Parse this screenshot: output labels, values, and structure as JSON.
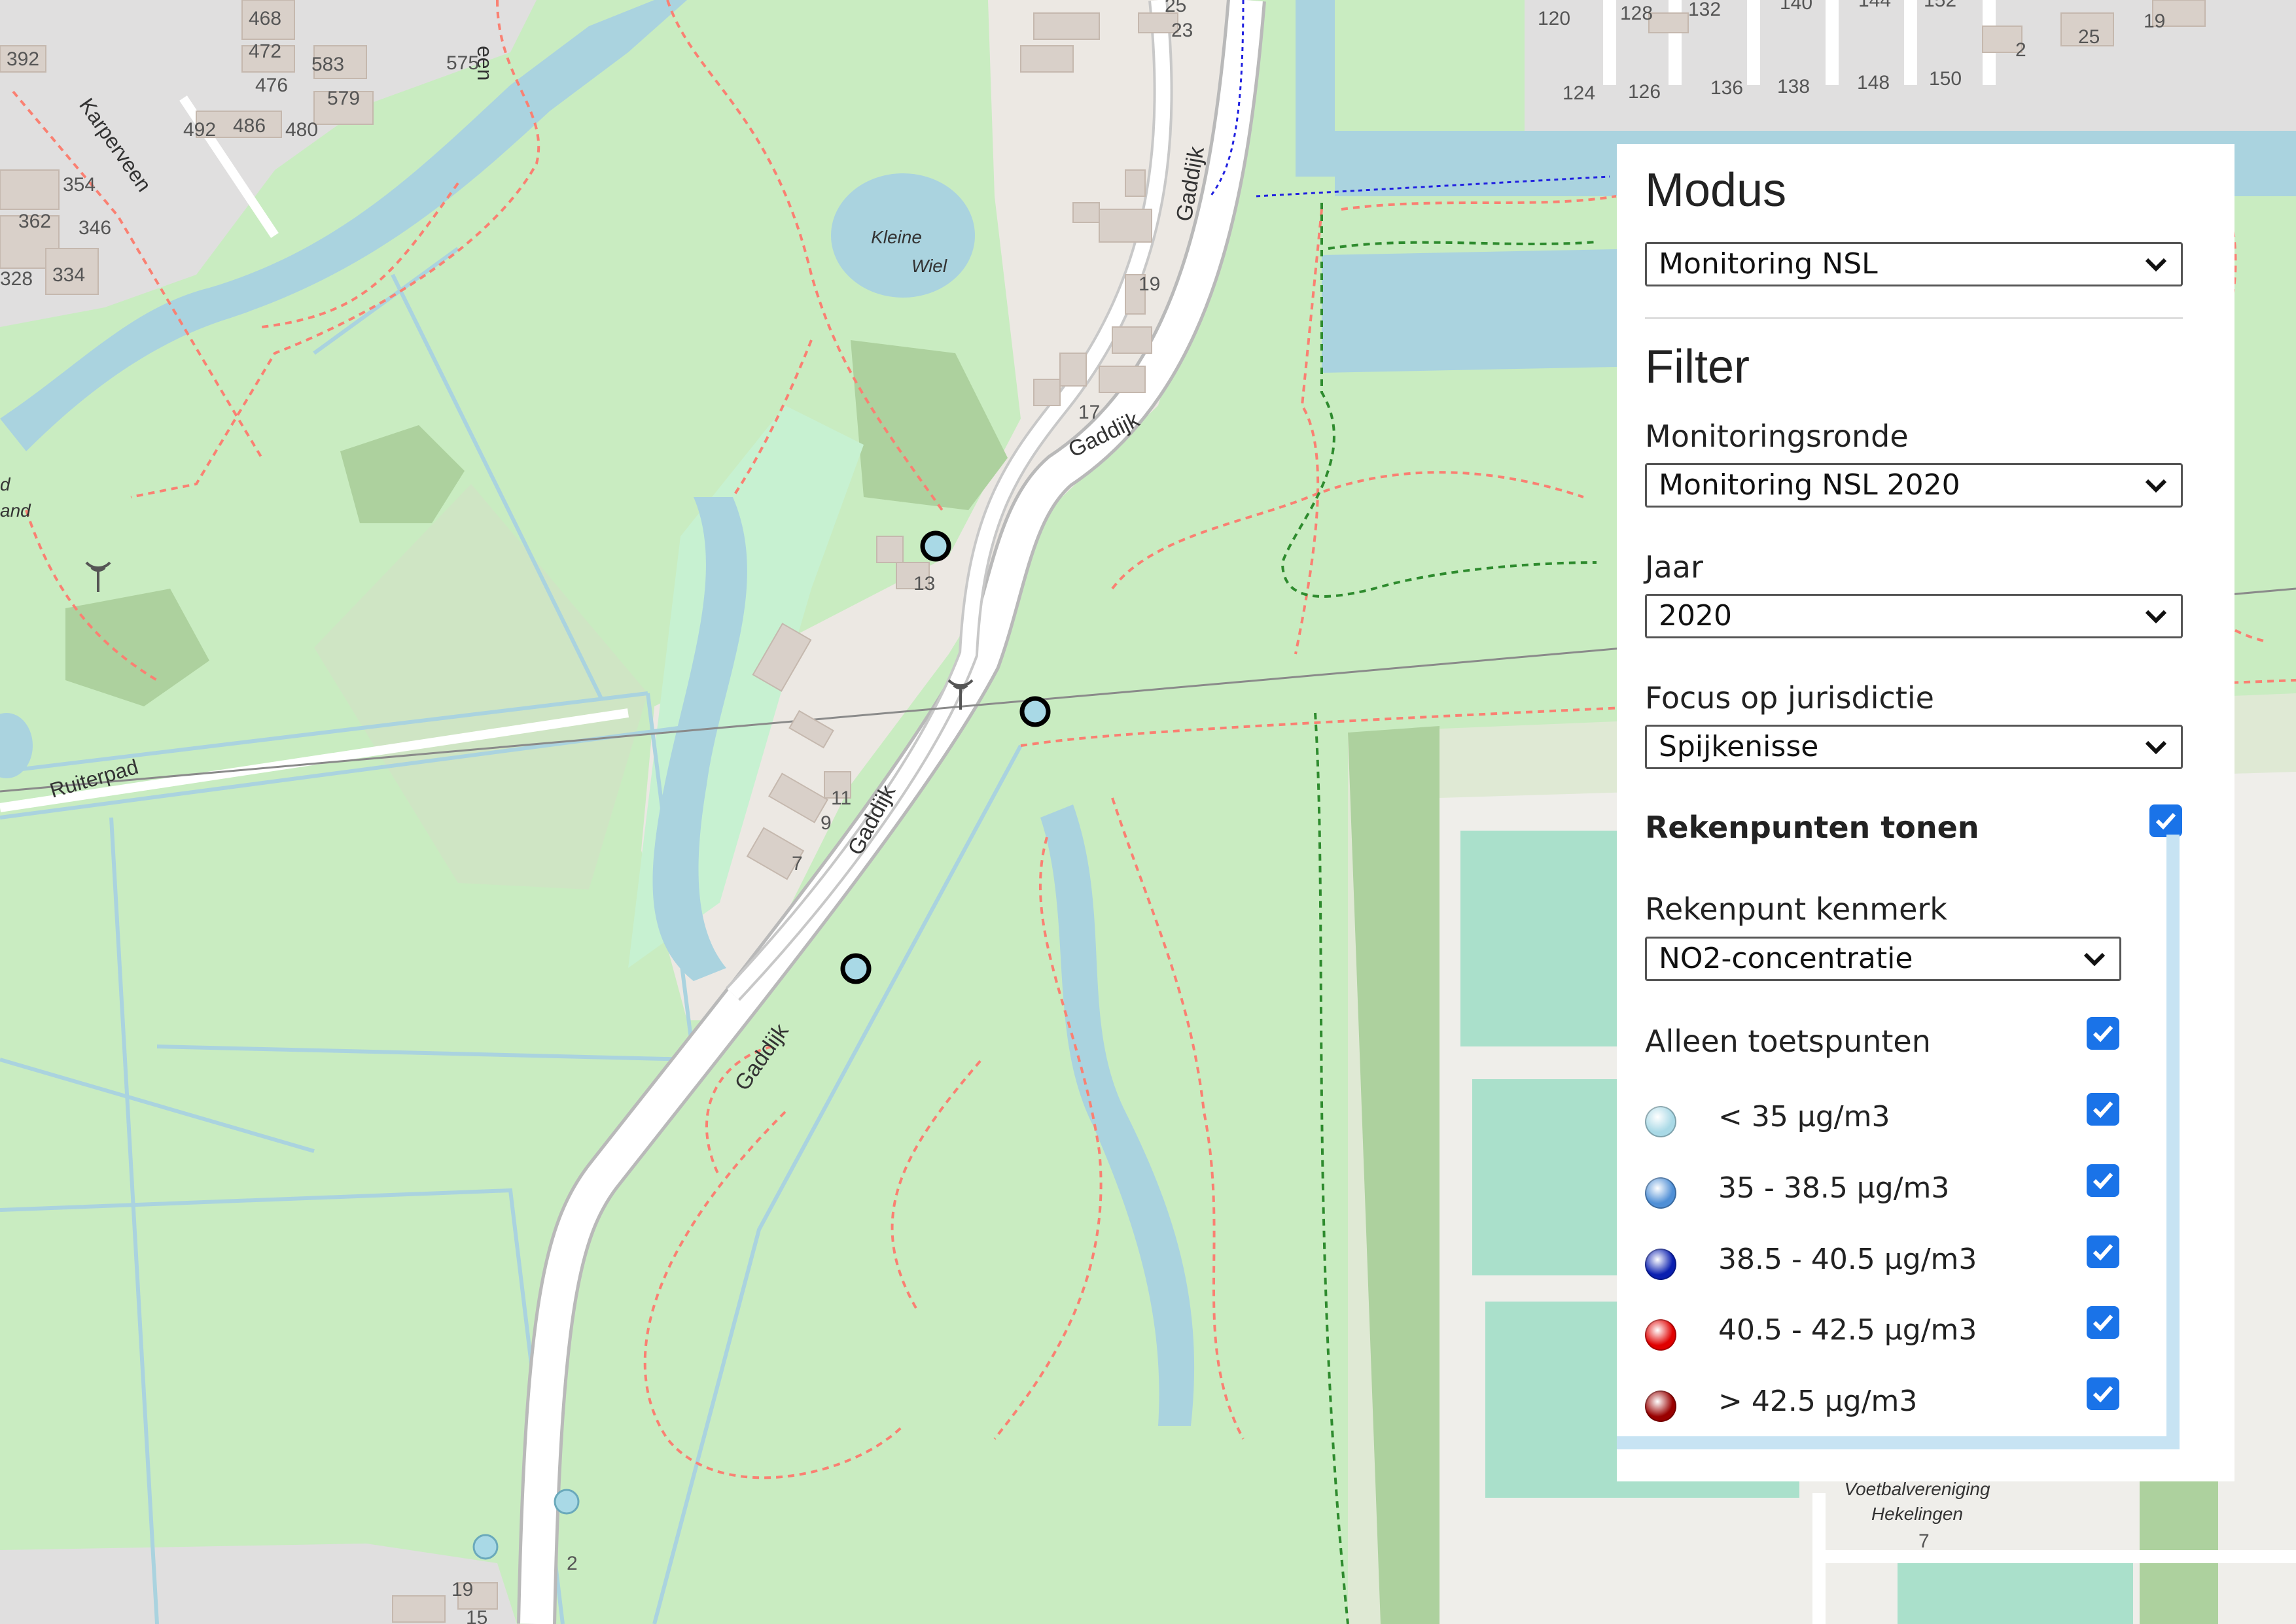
{
  "map": {
    "street_labels": [
      "Gaddijk",
      "Gaddijk",
      "Gaddijk",
      "Gaddijk",
      "Ruiterpad",
      "Karperveen",
      "een"
    ],
    "water_labels": [
      "Kleine",
      "Wiel"
    ],
    "partial_labels": [
      "d",
      "and"
    ],
    "club_label_1": "Voetbalvereniging",
    "club_label_2": "Hekelingen",
    "house_numbers": [
      "468",
      "472",
      "583",
      "476",
      "579",
      "492",
      "486",
      "480",
      "575",
      "392",
      "354",
      "362",
      "346",
      "328",
      "334",
      "25",
      "23",
      "19",
      "17",
      "13",
      "11",
      "9",
      "7",
      "2",
      "19",
      "15",
      "120",
      "128",
      "132",
      "140",
      "144",
      "152",
      "124",
      "126",
      "136",
      "138",
      "148",
      "150",
      "2",
      "25",
      "19",
      "7"
    ],
    "monitor_points": [
      {
        "category": "< 35 µg/m3",
        "color": "#a9d9e6",
        "outlined": true
      },
      {
        "category": "< 35 µg/m3",
        "color": "#a9d9e6",
        "outlined": true
      },
      {
        "category": "< 35 µg/m3",
        "color": "#a9d9e6",
        "outlined": true
      },
      {
        "category": "< 35 µg/m3",
        "color": "#a9d9e6",
        "outlined": false
      },
      {
        "category": "< 35 µg/m3",
        "color": "#a9d9e6",
        "outlined": false
      }
    ],
    "colors": {
      "land": "#c9ecc1",
      "park": "#cdebb0",
      "water": "#aad3df",
      "road": "#ffffff",
      "urban": "#e0dfdf",
      "building": "#d9d0c9",
      "path": "#fa8072",
      "forest": "#add19e",
      "pitch": "#aae0cb"
    }
  },
  "panel": {
    "modus_title": "Modus",
    "modus_value": "Monitoring NSL",
    "filter_title": "Filter",
    "ronde_label": "Monitoringsronde",
    "ronde_value": "Monitoring NSL 2020",
    "jaar_label": "Jaar",
    "jaar_value": "2020",
    "focus_label": "Focus op jurisdictie",
    "focus_value": "Spijkenisse",
    "rekenpunten_label": "Rekenpunten tonen",
    "rekenpunten_checked": true,
    "kenmerk_label": "Rekenpunt kenmerk",
    "kenmerk_value": "NO2-concentratie",
    "toetspunten_label": "Alleen toetspunten",
    "toetspunten_checked": true,
    "legend": [
      {
        "label": "< 35 µg/m3",
        "color": "#a9d9e6",
        "checked": true
      },
      {
        "label": "35 - 38.5 µg/m3",
        "color": "#4f8fd6",
        "checked": true
      },
      {
        "label": "38.5 - 40.5 µg/m3",
        "color": "#0a1fb0",
        "checked": true
      },
      {
        "label": "40.5 - 42.5 µg/m3",
        "color": "#e00000",
        "checked": true
      },
      {
        "label": "> 42.5 µg/m3",
        "color": "#990000",
        "checked": true
      }
    ]
  }
}
